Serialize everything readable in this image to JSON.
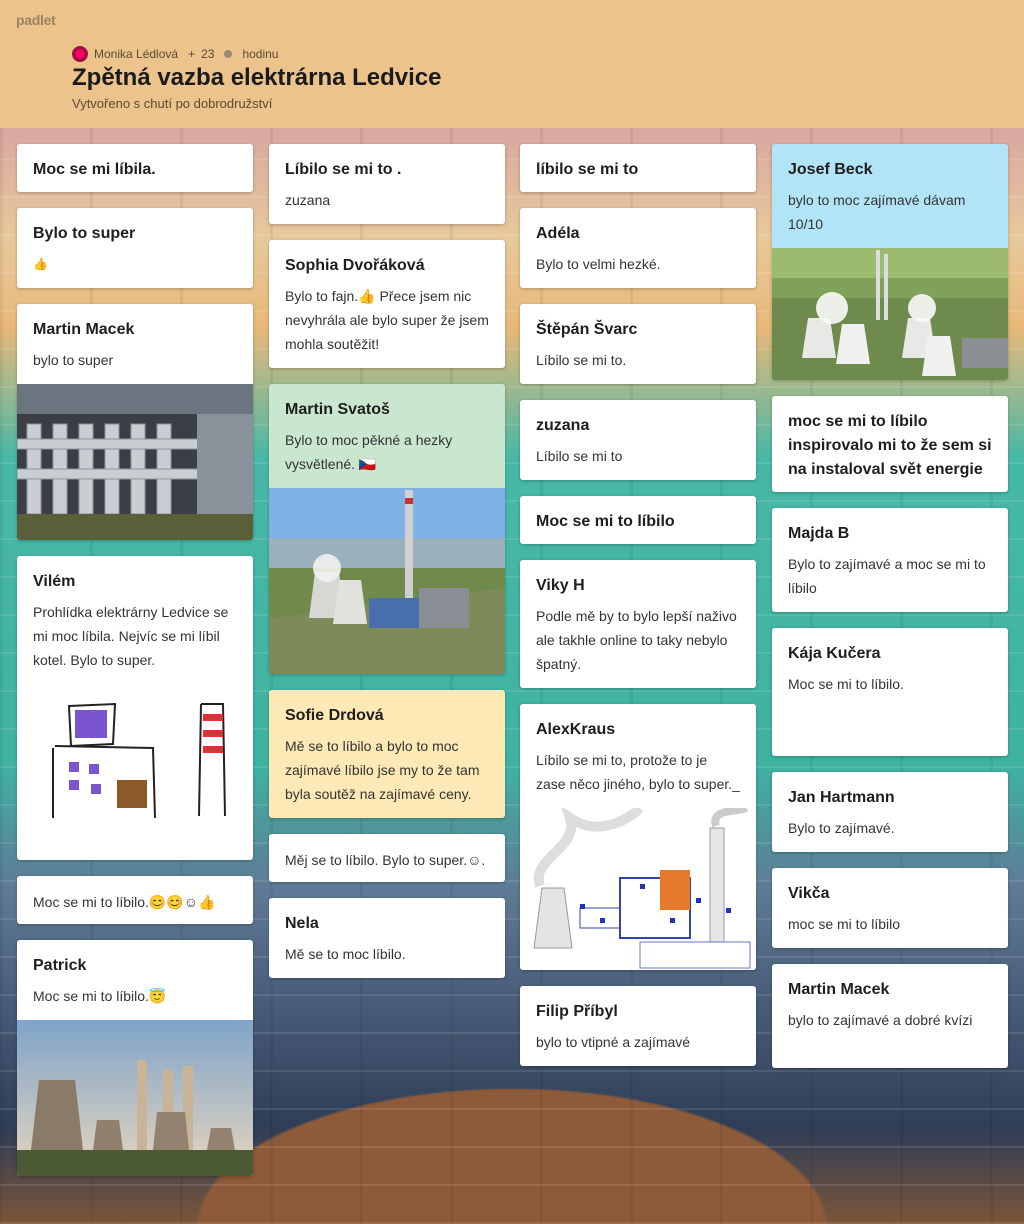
{
  "header": {
    "logo": "padlet",
    "author": "Monika Lédlová",
    "plus": "+",
    "count": "23",
    "time": "hodinu",
    "title": "Zpětná vazba elektrárna Ledvice",
    "subtitle": "Vytvořeno s chutí po dobrodružství"
  },
  "columns": [
    [
      {
        "text": "Moc se mi líbila."
      },
      {
        "title": "Bylo to super",
        "text": "👍"
      },
      {
        "title": "Martin Macek",
        "text": "bylo to super",
        "image": "industrial-pipes-photo"
      },
      {
        "title": "Vilém",
        "text": "Prohlídka elektrárny Ledvice se mi moc líbila. Nejvíc se mi líbil kotel. Bylo to super.",
        "image": "kid-drawing"
      },
      {
        "text": "Moc se mi to líbilo.😊😊☺👍"
      },
      {
        "title": "Patrick",
        "text": "Moc se mi to líbilo.😇",
        "image": "cooling-towers-photo"
      }
    ],
    [
      {
        "title": "Líbilo se mi to .",
        "text": "zuzana"
      },
      {
        "title": "Sophia Dvořáková",
        "text": "Bylo to fajn.👍 Přece jsem nic nevyhrála ale bylo super  že jsem mohla soutěžit!"
      },
      {
        "title": "Martin Svatoš",
        "text": "Bylo to moc pěkné a hezky vysvětlené. 🇨🇿",
        "image": "power-plant-aerial-photo",
        "color": "green"
      },
      {
        "title": "Sofie Drdová",
        "text": "Mě se to líbilo a bylo to moc zajímavé líbilo jse my to že tam byla soutěž na zajímavé ceny.",
        "color": "yellow"
      },
      {
        "text": "Měj se to líbilo. Bylo to super.☺."
      },
      {
        "title": "Nela",
        "text": "Mě se to moc líbilo."
      }
    ],
    [
      {
        "title": "líbilo se mi to"
      },
      {
        "title": "Adéla",
        "text": "Bylo to velmi hezké."
      },
      {
        "title": "Štěpán Švarc",
        "text": "Líbilo se mi to."
      },
      {
        "title": "zuzana",
        "text": "Líbilo se mi to"
      },
      {
        "title": "Moc se mi to líbilo"
      },
      {
        "title": "Viky H",
        "text": "Podle mě by to bylo lepší naživo ale takhle online to taky nebylo špatný."
      },
      {
        "title": "AlexKraus",
        "text": " Líbilo se mi to, protože to je zase něco jiného, bylo to super._",
        "image": "power-plant-diagram"
      },
      {
        "title": "Filip Příbyl",
        "text": "bylo to vtipné a zajímavé"
      }
    ],
    [
      {
        "title": "Josef Beck",
        "text": "bylo to moc zajímavé dávam 10/10",
        "image": "power-plant-landscape-photo",
        "color": "blue"
      },
      {
        "title": "moc se mi to líbilo inspirovalo mi to že sem si na instaloval svět energie"
      },
      {
        "title": "Majda B",
        "text": "Bylo to zajímavé a moc se mi to líbilo"
      },
      {
        "title": "Kája Kučera",
        "text": "Moc se  mi to líbilo."
      },
      {
        "title": "Jan Hartmann",
        "text": "Bylo to zajímavé."
      },
      {
        "title": "Vikča",
        "text": "moc se mi to líbilo"
      },
      {
        "title": "Martin Macek",
        "text": "bylo to zajímavé a dobré kvízi"
      }
    ]
  ]
}
